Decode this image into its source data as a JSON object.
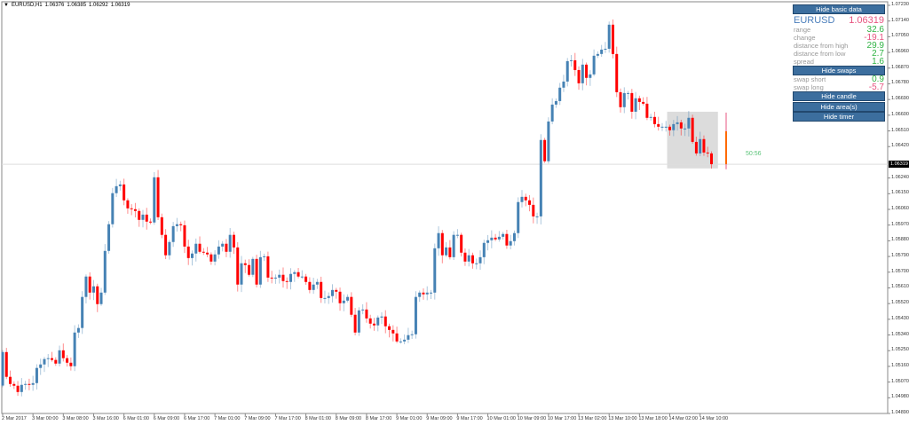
{
  "header": {
    "symbol": "EURUSD,H1",
    "open": "1.06376",
    "high": "1.06385",
    "low": "1.06292",
    "close": "1.06319"
  },
  "panel": {
    "hide_basic_data": "Hide basic data",
    "symbol": "EURUSD",
    "price": "1.06319",
    "rows": [
      {
        "label": "range",
        "value": "32.6",
        "color": "green"
      },
      {
        "label": "change",
        "value": "-19.1",
        "color": "pink"
      },
      {
        "label": "distance from high",
        "value": "29.9",
        "color": "green"
      },
      {
        "label": "distance from low",
        "value": "2.7",
        "color": "green"
      },
      {
        "label": "spread",
        "value": "1.6",
        "color": "green"
      }
    ],
    "hide_swaps": "Hide swaps",
    "swaps": [
      {
        "label": "swap short",
        "value": "0.9",
        "color": "green"
      },
      {
        "label": "swap long",
        "value": "-5.7",
        "color": "pink"
      }
    ],
    "hide_candle": "Hide candle",
    "hide_areas": "Hide area(s)",
    "hide_timer": "Hide timer"
  },
  "timer": "50:56",
  "current_price": "1.06319",
  "colors": {
    "bull": "#4682b4",
    "bear": "#ff0000",
    "htf": "#ff6a00",
    "area": "#d8d8d8"
  },
  "chart_data": {
    "type": "candlestick",
    "ylim": [
      1.0489,
      1.0723
    ],
    "yticks": [
      "1.07230",
      "1.07140",
      "1.07050",
      "1.06960",
      "1.06870",
      "1.06780",
      "1.06690",
      "1.06600",
      "1.06510",
      "1.06420",
      "1.06240",
      "1.06150",
      "1.06060",
      "1.05970",
      "1.05880",
      "1.05790",
      "1.05700",
      "1.05610",
      "1.05520",
      "1.05430",
      "1.05340",
      "1.05250",
      "1.05160",
      "1.05070",
      "1.04980",
      "1.04890"
    ],
    "xticks": [
      "2 Mar 2017",
      "3 Mar 00:00",
      "3 Mar 08:00",
      "3 Mar 16:00",
      "6 Mar 01:00",
      "6 Mar 09:00",
      "6 Mar 17:00",
      "7 Mar 01:00",
      "7 Mar 09:00",
      "7 Mar 17:00",
      "8 Mar 01:00",
      "8 Mar 09:00",
      "8 Mar 17:00",
      "9 Mar 01:00",
      "9 Mar 09:00",
      "9 Mar 17:00",
      "10 Mar 01:00",
      "10 Mar 09:00",
      "10 Mar 17:00",
      "13 Mar 02:00",
      "13 Mar 10:00",
      "13 Mar 18:00",
      "14 Mar 02:00",
      "14 Mar 10:00"
    ],
    "first_open": 1.0505,
    "closes": [
      1.05242,
      1.051,
      1.05059,
      1.05049,
      1.05013,
      1.05054,
      1.05059,
      1.05054,
      1.05064,
      1.05151,
      1.05171,
      1.05202,
      1.05207,
      1.05197,
      1.05176,
      1.05252,
      1.05207,
      1.05181,
      1.05161,
      1.05354,
      1.0538,
      1.05558,
      1.05675,
      1.05583,
      1.05619,
      1.05517,
      1.05583,
      1.05822,
      1.05975,
      1.06153,
      1.06193,
      1.06203,
      1.06112,
      1.06066,
      1.06061,
      1.06051,
      1.06,
      1.0603,
      1.0599,
      1.05985,
      1.06244,
      1.06015,
      1.05914,
      1.05797,
      1.05873,
      1.05964,
      1.05975,
      1.05969,
      1.05847,
      1.05781,
      1.05807,
      1.05863,
      1.05817,
      1.05812,
      1.05802,
      1.05761,
      1.05802,
      1.05847,
      1.05863,
      1.05817,
      1.05914,
      1.05842,
      1.05629,
      1.05751,
      1.05741,
      1.05685,
      1.05776,
      1.05629,
      1.05786,
      1.05791,
      1.05669,
      1.05664,
      1.05669,
      1.05685,
      1.05649,
      1.05644,
      1.0569,
      1.057,
      1.05675,
      1.05675,
      1.05644,
      1.05598,
      1.05629,
      1.05644,
      1.05552,
      1.05552,
      1.05563,
      1.05598,
      1.05588,
      1.05522,
      1.05537,
      1.05558,
      1.05456,
      1.05354,
      1.05481,
      1.05486,
      1.05435,
      1.05405,
      1.05395,
      1.0544,
      1.05446,
      1.0539,
      1.05369,
      1.05349,
      1.05303,
      1.05303,
      1.05313,
      1.05339,
      1.05344,
      1.05558,
      1.05583,
      1.05573,
      1.05583,
      1.05583,
      1.05837,
      1.05924,
      1.05797,
      1.05842,
      1.05786,
      1.05914,
      1.05914,
      1.05812,
      1.05761,
      1.05797,
      1.05751,
      1.05751,
      1.05786,
      1.05868,
      1.05883,
      1.05898,
      1.05888,
      1.05903,
      1.05919,
      1.05853,
      1.05878,
      1.05924,
      1.06102,
      1.06132,
      1.06112,
      1.06086,
      1.0602,
      1.0602,
      1.06458,
      1.06336,
      1.06564,
      1.06661,
      1.06681,
      1.06758,
      1.06793,
      1.0691,
      1.06915,
      1.06859,
      1.06783,
      1.0689,
      1.06814,
      1.06834,
      1.06941,
      1.06951,
      1.06976,
      1.06981,
      1.07119,
      1.06951,
      1.06732,
      1.06646,
      1.06727,
      1.06727,
      1.0662,
      1.06697,
      1.06676,
      1.06666,
      1.06585,
      1.0659,
      1.06549,
      1.06534,
      1.06534,
      1.06534,
      1.06514,
      1.06549,
      1.06559,
      1.06524,
      1.06524,
      1.06585,
      1.06447,
      1.06381,
      1.06463,
      1.06386,
      1.06381,
      1.06319
    ],
    "htf_candle": {
      "open": 1.06508,
      "high": 1.06615,
      "low": 1.0629,
      "close": 1.06319
    },
    "area": {
      "from_index": 176,
      "to_index": 188,
      "high": 1.0662,
      "low": 1.06295
    }
  }
}
